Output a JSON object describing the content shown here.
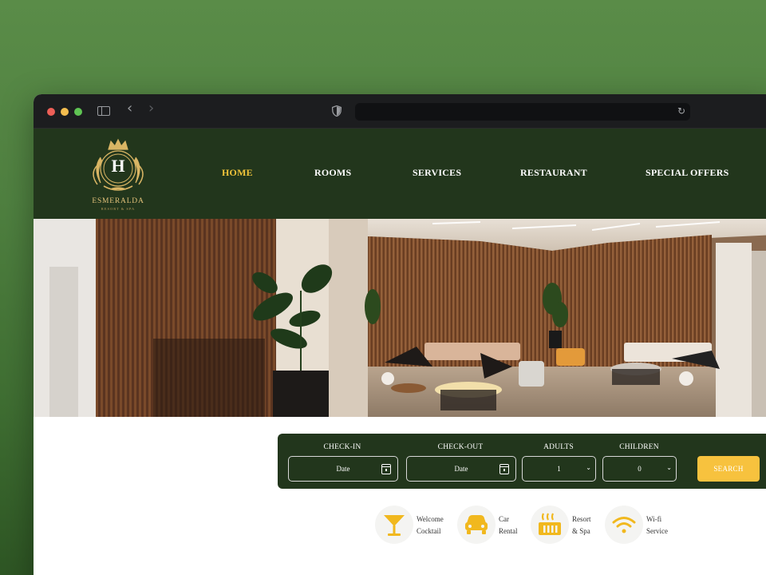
{
  "browser": {
    "url": "",
    "controls": [
      "close",
      "minimize",
      "zoom"
    ]
  },
  "logo": {
    "letter": "H",
    "name": "ESMERALDA",
    "tagline": "RESORT & SPA"
  },
  "nav": {
    "items": [
      {
        "label": "HOME",
        "active": true
      },
      {
        "label": "ROOMS",
        "active": false
      },
      {
        "label": "SERVICES",
        "active": false
      },
      {
        "label": "RESTAURANT",
        "active": false
      },
      {
        "label": "SPECIAL OFFERS",
        "active": false
      }
    ]
  },
  "booking": {
    "checkin_label": "CHECK-IN",
    "checkin_value": "Date",
    "checkout_label": "CHECK-OUT",
    "checkout_value": "Date",
    "adults_label": "ADULTS",
    "adults_value": "1",
    "children_label": "CHILDREN",
    "children_value": "0",
    "search_label": "SEARCH"
  },
  "amenities": [
    {
      "label": "Welcome\nCocktail",
      "icon": "cocktail-icon"
    },
    {
      "label": "Car\nRental",
      "icon": "car-icon"
    },
    {
      "label": "Resort\n& Spa",
      "icon": "spa-icon"
    },
    {
      "label": "Wi-fi\nService",
      "icon": "wifi-icon"
    }
  ],
  "colors": {
    "header_bg": "#22361c",
    "accent": "#f0c43a",
    "button": "#f7c23e",
    "page_bg": "#4f8040"
  }
}
